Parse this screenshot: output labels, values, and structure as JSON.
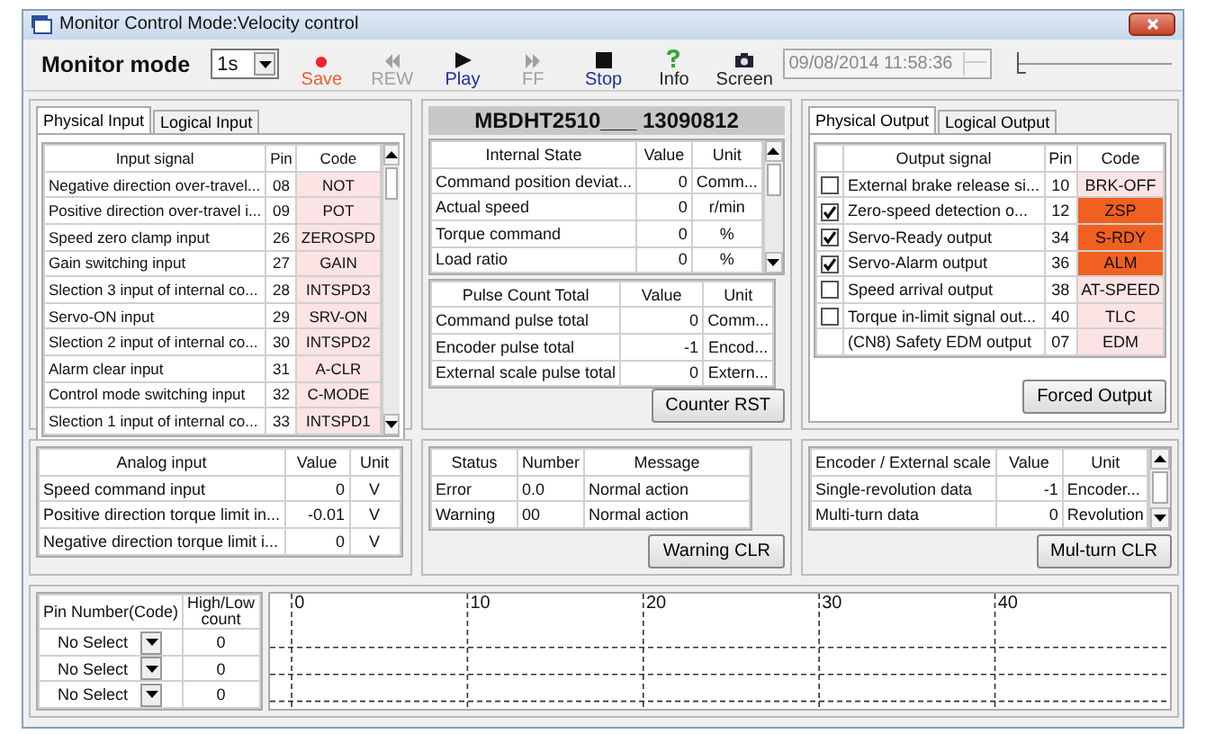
{
  "window": {
    "title": "Monitor  Control Mode:Velocity control"
  },
  "toolbar": {
    "label": "Monitor mode",
    "interval": "1s",
    "tools": [
      {
        "kind": "record",
        "label": "Save",
        "color": "#e8602c"
      },
      {
        "kind": "rewind",
        "label": "REW",
        "color": "#a0a0a0"
      },
      {
        "kind": "play",
        "label": "Play",
        "color": "#1f2f9a"
      },
      {
        "kind": "forward",
        "label": "FF",
        "color": "#a0a0a0"
      },
      {
        "kind": "stop",
        "label": "Stop",
        "color": "#1f2f9a"
      },
      {
        "kind": "info",
        "label": "Info",
        "color": "#222222"
      },
      {
        "kind": "camera",
        "label": "Screen",
        "color": "#222222"
      }
    ],
    "timestamp": "09/08/2014 11:58:36",
    "slider": {
      "level": 0
    }
  },
  "input_panel": {
    "tabs": [
      {
        "label": "Physical Input",
        "selected": true
      },
      {
        "label": "Logical Input",
        "selected": false
      }
    ],
    "columns": [
      "Input signal",
      "Pin",
      "Code"
    ],
    "rows": [
      {
        "signal": "Negative direction over-travel...",
        "pin": "08",
        "code": "NOT",
        "on": false
      },
      {
        "signal": "Positive direction over-travel i...",
        "pin": "09",
        "code": "POT",
        "on": false
      },
      {
        "signal": "Speed zero clamp input",
        "pin": "26",
        "code": "ZEROSPD",
        "on": false
      },
      {
        "signal": "Gain switching input",
        "pin": "27",
        "code": "GAIN",
        "on": false
      },
      {
        "signal": "Slection 3 input of internal co...",
        "pin": "28",
        "code": "INTSPD3",
        "on": false
      },
      {
        "signal": "Servo-ON input",
        "pin": "29",
        "code": "SRV-ON",
        "on": false
      },
      {
        "signal": "Slection 2 input of internal co...",
        "pin": "30",
        "code": "INTSPD2",
        "on": false
      },
      {
        "signal": "Alarm clear input",
        "pin": "31",
        "code": "A-CLR",
        "on": false
      },
      {
        "signal": "Control mode switching input",
        "pin": "32",
        "code": "C-MODE",
        "on": false
      },
      {
        "signal": "Slection 1 input of internal co...",
        "pin": "33",
        "code": "INTSPD1",
        "on": false
      }
    ]
  },
  "drive_panel": {
    "model": "MBDHT2510___ 13090812",
    "internal_state": {
      "columns": [
        "Internal State",
        "Value",
        "Unit"
      ],
      "rows": [
        [
          "Command position deviat...",
          "0",
          "Comm..."
        ],
        [
          "Actual speed",
          "0",
          "r/min"
        ],
        [
          "Torque command",
          "0",
          "%"
        ],
        [
          "Load ratio",
          "0",
          "%"
        ]
      ]
    },
    "pulse_count": {
      "columns": [
        "Pulse Count Total",
        "Value",
        "Unit"
      ],
      "rows": [
        [
          "Command pulse total",
          "0",
          "Comm..."
        ],
        [
          "Encoder pulse total",
          "-1",
          "Encod..."
        ],
        [
          "External scale pulse total",
          "0",
          "Extern..."
        ]
      ]
    },
    "button": "Counter RST"
  },
  "output_panel": {
    "tabs": [
      {
        "label": "Physical Output",
        "selected": true
      },
      {
        "label": "Logical Output",
        "selected": false
      }
    ],
    "columns": [
      "Output signal",
      "Pin",
      "Code"
    ],
    "rows": [
      {
        "kind": "check",
        "checked": false,
        "signal": "External brake release si...",
        "pin": "10",
        "code": "BRK-OFF",
        "on": false
      },
      {
        "kind": "check",
        "checked": true,
        "signal": "Zero-speed detection o...",
        "pin": "12",
        "code": "ZSP",
        "on": true
      },
      {
        "kind": "check",
        "checked": true,
        "signal": "Servo-Ready output",
        "pin": "34",
        "code": "S-RDY",
        "on": true
      },
      {
        "kind": "check",
        "checked": true,
        "signal": "Servo-Alarm output",
        "pin": "36",
        "code": "ALM",
        "on": true
      },
      {
        "kind": "check",
        "checked": false,
        "signal": "Speed arrival output",
        "pin": "38",
        "code": "AT-SPEED",
        "on": false
      },
      {
        "kind": "check",
        "checked": false,
        "signal": "Torque in-limit signal out...",
        "pin": "40",
        "code": "TLC",
        "on": false
      },
      {
        "kind": "plain",
        "signal": "(CN8) Safety EDM output",
        "pin": "07",
        "code": "EDM",
        "on": false
      }
    ],
    "button": "Forced Output"
  },
  "analog_panel": {
    "columns": [
      "Analog input",
      "Value",
      "Unit"
    ],
    "rows": [
      [
        "Speed command input",
        "0",
        "V"
      ],
      [
        "Positive direction torque limit in...",
        "-0.01",
        "V"
      ],
      [
        "Negative direction torque limit i...",
        "0",
        "V"
      ]
    ]
  },
  "status_panel": {
    "columns": [
      "Status",
      "Number",
      "Message"
    ],
    "rows": [
      [
        "Error",
        "0.0",
        "Normal action"
      ],
      [
        "Warning",
        "00",
        "Normal action"
      ]
    ],
    "button": "Warning CLR"
  },
  "encoder_panel": {
    "columns": [
      "Encoder / External scale",
      "Value",
      "Unit"
    ],
    "rows": [
      [
        "Single-revolution data",
        "-1",
        "Encoder..."
      ],
      [
        "Multi-turn data",
        "0",
        "Revolution"
      ]
    ],
    "button": "Mul-turn CLR"
  },
  "pin_panel": {
    "columns": [
      "Pin Number(Code)",
      "High/Low count"
    ],
    "rows": [
      {
        "pin": "No Select",
        "count": "0"
      },
      {
        "pin": "No Select",
        "count": "0"
      },
      {
        "pin": "No Select",
        "count": "0"
      }
    ]
  },
  "timeline": {
    "ticks": [
      "0",
      "10",
      "20",
      "30",
      "40"
    ]
  }
}
